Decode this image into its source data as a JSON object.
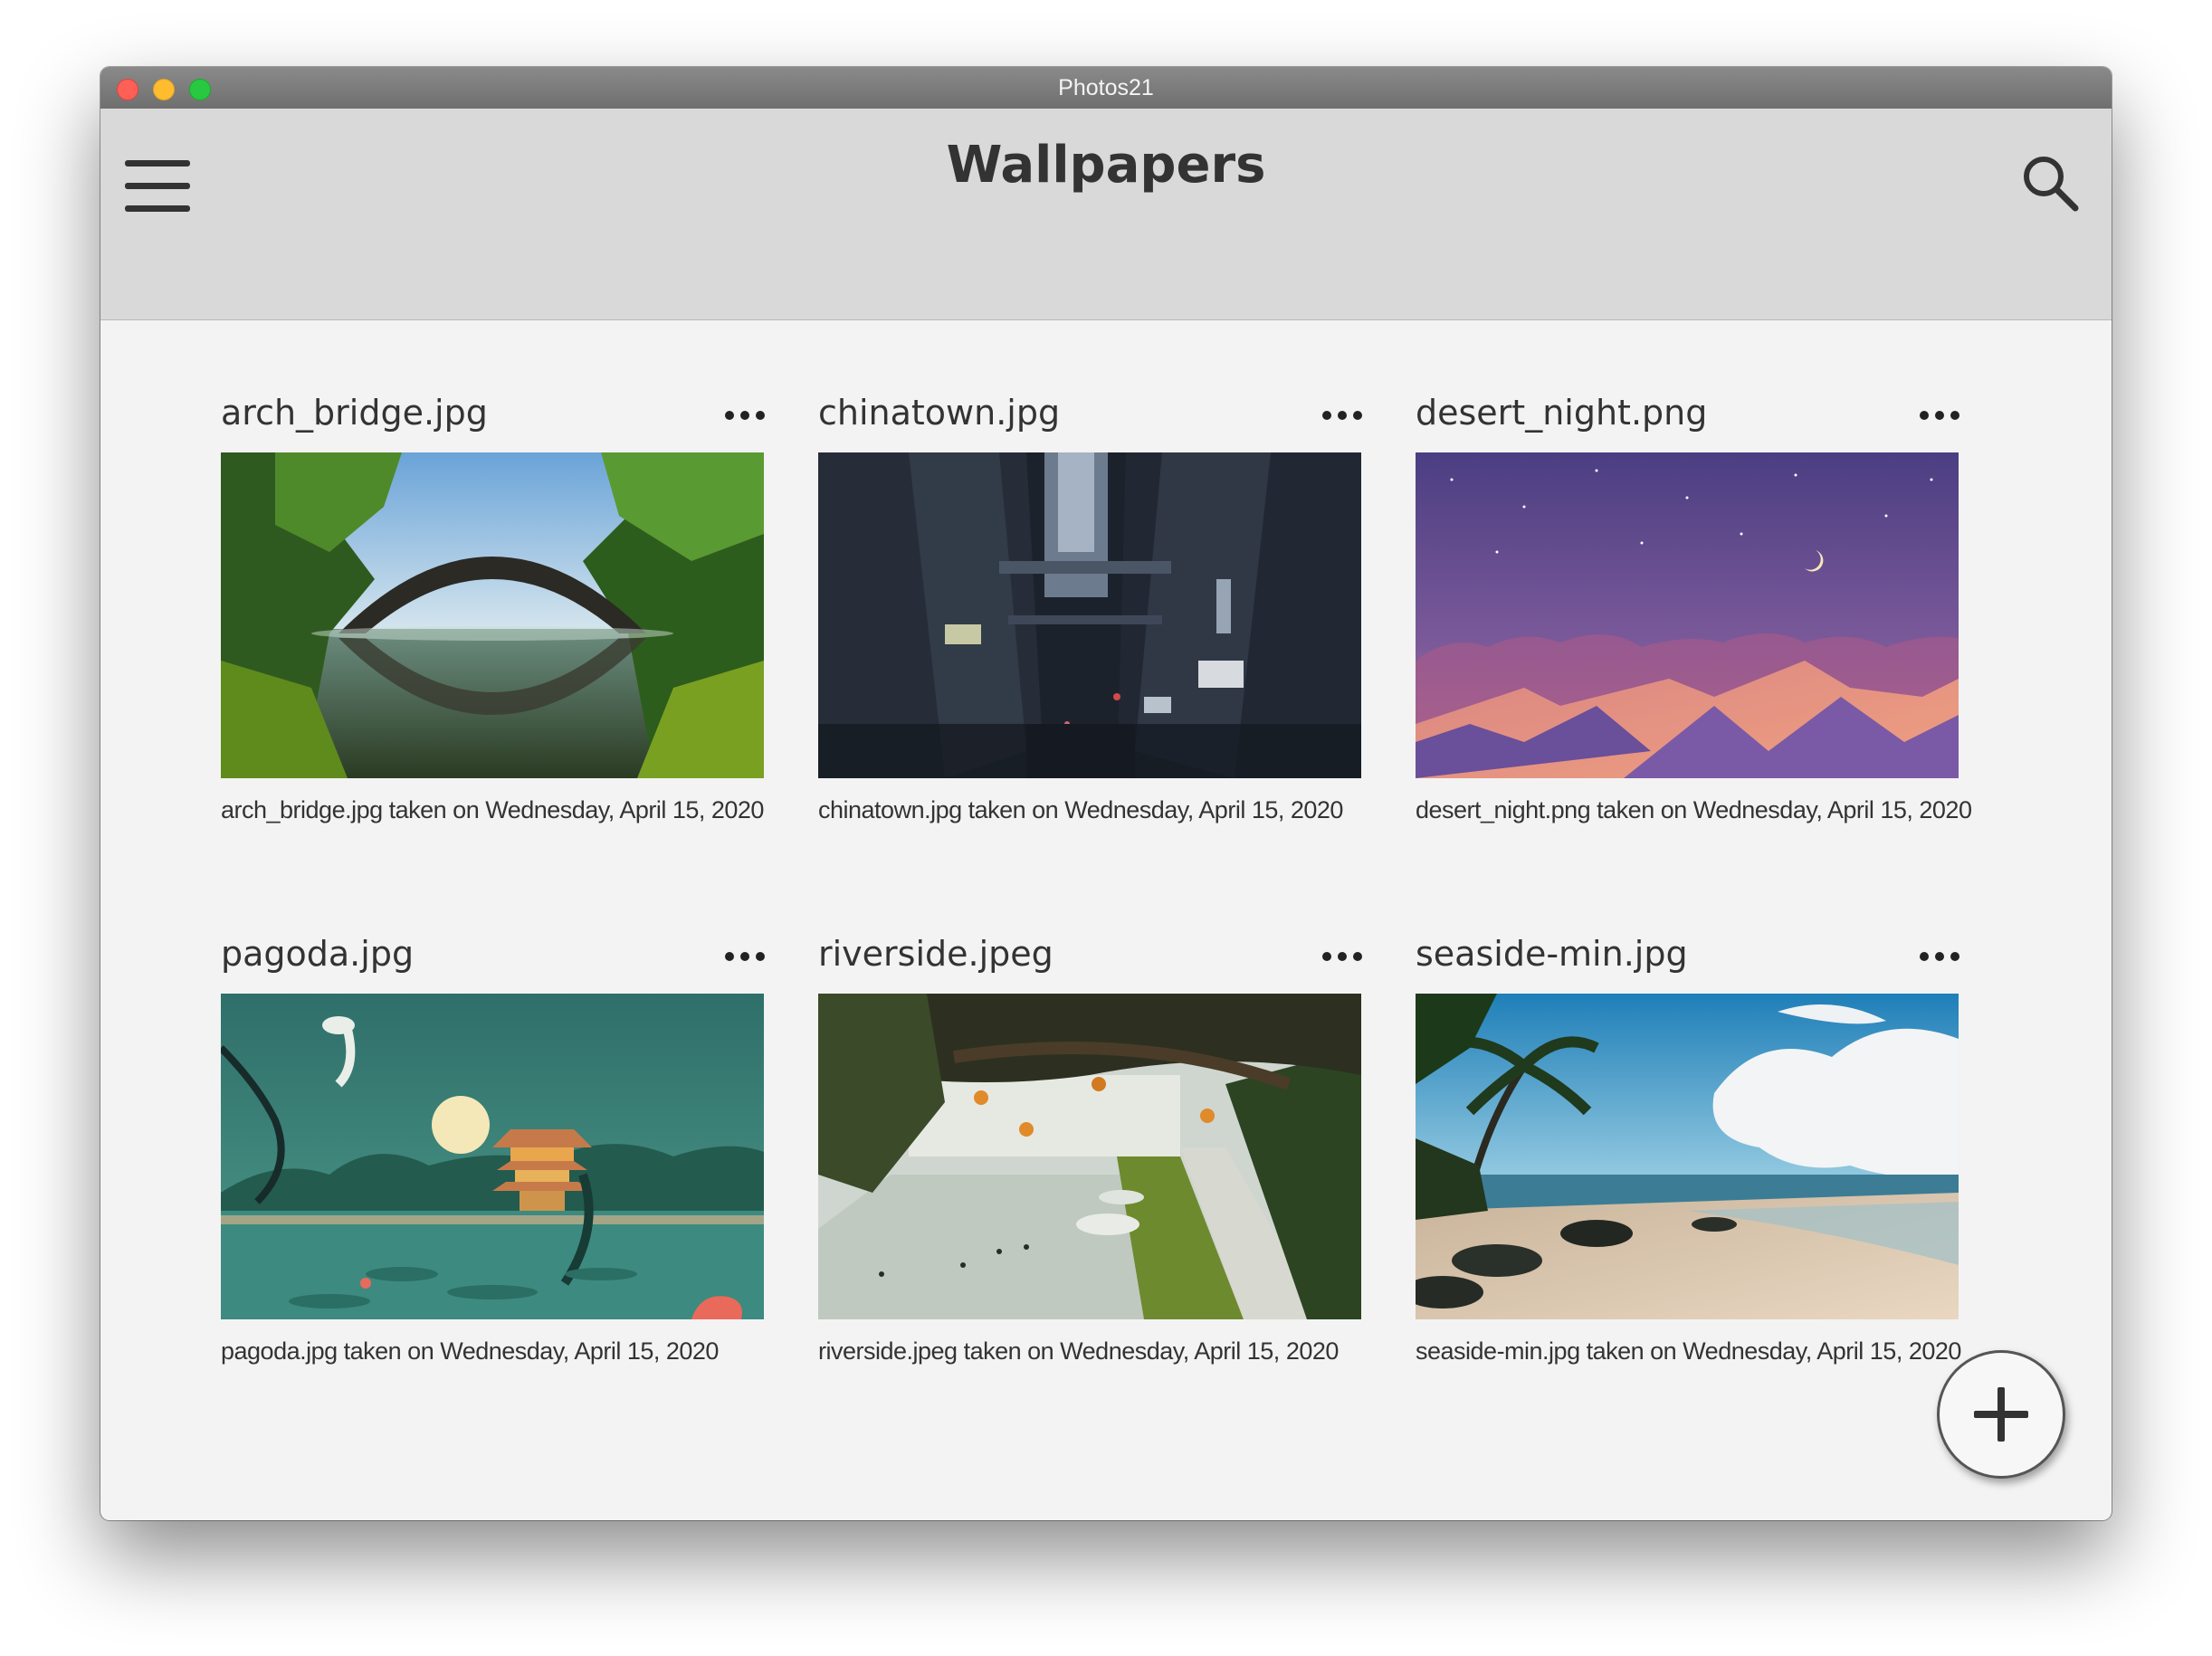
{
  "window": {
    "title": "Photos21"
  },
  "header": {
    "title": "Wallpapers",
    "menu_icon": "hamburger-menu-icon",
    "search_icon": "search-icon"
  },
  "photos": [
    {
      "filename": "arch_bridge.jpg",
      "caption": "arch_bridge.jpg taken on Wednesday, April 15, 2020"
    },
    {
      "filename": "chinatown.jpg",
      "caption": "chinatown.jpg taken on Wednesday, April 15, 2020"
    },
    {
      "filename": "desert_night.png",
      "caption": "desert_night.png taken on Wednesday, April 15, 2020"
    },
    {
      "filename": "pagoda.jpg",
      "caption": "pagoda.jpg taken on Wednesday, April 15, 2020"
    },
    {
      "filename": "riverside.jpeg",
      "caption": "riverside.jpeg taken on Wednesday, April 15, 2020"
    },
    {
      "filename": "seaside-min.jpg",
      "caption": "seaside-min.jpg taken on Wednesday, April 15, 2020"
    }
  ],
  "fab": {
    "icon": "plus-icon"
  },
  "colors": {
    "appbar": "#d9d9d9",
    "background": "#f3f3f3",
    "text": "#333333"
  }
}
